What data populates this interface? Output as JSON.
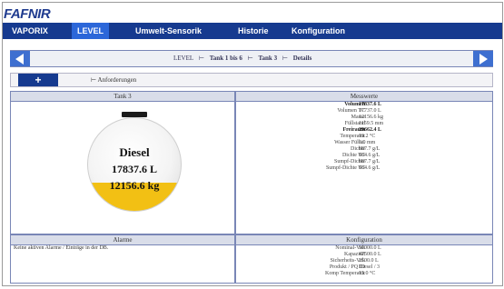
{
  "app": {
    "logo": "FAFNIR"
  },
  "menu": [
    {
      "label": "VAPORIX",
      "active": false
    },
    {
      "label": "LEVEL",
      "active": true
    },
    {
      "label": "Umwelt-Sensorik",
      "active": false
    },
    {
      "label": "Historie",
      "active": false
    },
    {
      "label": "Konfiguration",
      "active": false
    }
  ],
  "breadcrumb": [
    "LEVEL",
    "Tank 1 bis 6",
    "Tank 3",
    "Details"
  ],
  "breadcrumb_separator": "⊢",
  "subbar": {
    "plus_label": "+",
    "requests_label": "⊢ Anforderungen"
  },
  "tank_panel": {
    "header": "Tank 3",
    "product": "Diesel",
    "volume": "17837.6 L",
    "mass": "12156.6 kg",
    "fill_fraction": 0.3
  },
  "measurements": {
    "header": "Messwerte",
    "rows": [
      {
        "label": "Volumen",
        "value": "17837.6 L",
        "bold": true
      },
      {
        "label": "Volumen TC",
        "value": "17737.0 L",
        "bold": false
      },
      {
        "label": "Masse",
        "value": "12156.6 kg",
        "bold": false
      },
      {
        "label": "Füllstand",
        "value": "1159.5 mm",
        "bold": false
      },
      {
        "label": "Freiraum",
        "value": "29662.4 L",
        "bold": true
      },
      {
        "label": "Temperatur",
        "value": "19.2 °C",
        "bold": false
      },
      {
        "label": "Wasser Füllst.",
        "value": "0.0 mm",
        "bold": false
      },
      {
        "label": "Dichte",
        "value": "687.7 g/L",
        "bold": false
      },
      {
        "label": "Dichte TC",
        "value": "684.6 g/L",
        "bold": false
      },
      {
        "label": "Sumpf-Dichte",
        "value": "687.7 g/L",
        "bold": false
      },
      {
        "label": "Sumpf-Dichte TC",
        "value": "684.6 g/L",
        "bold": false
      }
    ]
  },
  "alarms": {
    "header": "Alarme",
    "text": "Keine aktiven Alarme / Einträge in der DB."
  },
  "configuration": {
    "header": "Konfiguration",
    "rows": [
      {
        "label": "Nominal-Vol.",
        "value": "50000.0 L"
      },
      {
        "label": "Kapazität",
        "value": "47500.0 L"
      },
      {
        "label": "Sicherheits-Vol.",
        "value": "2500.0 L"
      },
      {
        "label": "Produkt / PQ ID",
        "value": "Diesel / 3"
      },
      {
        "label": "Komp Temperatur",
        "value": "15.0 °C"
      }
    ]
  },
  "colors": {
    "menu_bg": "#163a8f",
    "menu_active": "#2c67d9",
    "arrow": "#3e6fd0",
    "fuel": "#f2c014"
  }
}
